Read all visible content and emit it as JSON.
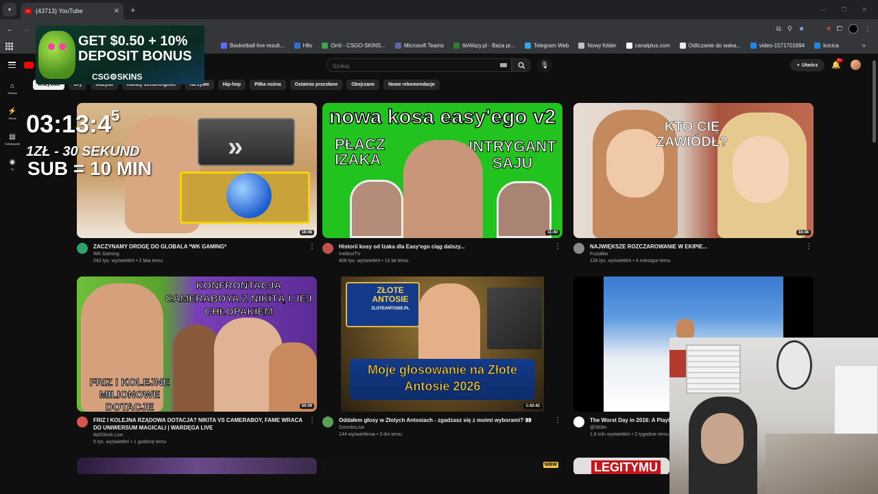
{
  "browser": {
    "tab_title": "(43713) YouTube",
    "bookmarks": [
      {
        "label": "Basketball live result...",
        "color": "#5b6bff"
      },
      {
        "label": "Hltv",
        "color": "#2f6fd6"
      },
      {
        "label": "Orrti - CSGO-SKINS...",
        "color": "#34a853"
      },
      {
        "label": "Microsoft Teams",
        "color": "#6264a7"
      },
      {
        "label": "IleWazy.pl - Baza pr...",
        "color": "#2e7d32"
      },
      {
        "label": "Telegram Web",
        "color": "#2aabee"
      },
      {
        "label": "Nowy folder",
        "color": "#bdc1c6"
      },
      {
        "label": "canalplus.com",
        "color": "#ffffff"
      },
      {
        "label": "Odliczanie do waka...",
        "color": "#e8eaed"
      },
      {
        "label": "video-1571701694",
        "color": "#1e88e5"
      },
      {
        "label": "kocica",
        "color": "#1e88e5"
      }
    ]
  },
  "youtube": {
    "search_placeholder": "Szukaj",
    "create_label": "Utwórz",
    "notif_count": "9+",
    "sidebar": [
      {
        "icon": "⌂",
        "label": "Główna"
      },
      {
        "icon": "⚡",
        "label": "Shorts"
      },
      {
        "icon": "▤",
        "label": "Subskrypcje"
      },
      {
        "icon": "◉",
        "label": "Ty"
      }
    ],
    "chips": [
      "Wszystko",
      "Gry",
      "Muzyka",
      "Kanały streamingowe",
      "Na żywo",
      "Hip-hop",
      "Piłka nożna",
      "Ostatnio przesłane",
      "Obejrzane",
      "Nowe rekomendacje"
    ],
    "videos": [
      {
        "title": "ZACZYNAMY DROGĘ DO GLOBALA *WK GAMING*",
        "channel": "WK Gaming",
        "stats": "242 tys. wyświetleń • 2 lata temu",
        "duration": "18:48",
        "avatar_color": "#2ea36b"
      },
      {
        "title": "Historii kosy od Izaka dla Easy'ego ciąg dalszy...",
        "channel": "InetkoxTV",
        "stats": "409 tys. wyświetleń • 10 lat temu",
        "duration": "11:40",
        "avatar_color": "#c05050"
      },
      {
        "title": "NAJWIĘKSZE ROZCZAROWANIE W EKIPIE...",
        "channel": "Fusialka",
        "stats": "126 tys. wyświetleń • 4 miesiące temu",
        "duration": "18:38",
        "avatar_color": "#8a8a8a"
      },
      {
        "title": "FRIZ I KOLEJNA RZĄDOWA DOTACJA? NIKITA VS CAMERABOY, FAME WRACA DO UNIWERSUM MAGICALI | WARDĘGA LIVE",
        "channel": "WATAHA Live",
        "stats": "5 tys. wyświetleń • 1 godzinę temu",
        "duration": "50:09",
        "avatar_color": "#d9534f"
      },
      {
        "title": "Oddałem głosy w Złotych Antosiach  - zgadzasz się z moimi wyborami? 👀",
        "channel": "GremlinLive",
        "stats": "144 wyświetlenia • 3 dni temu",
        "duration": "1:43:42",
        "avatar_color": "#5aa05a"
      },
      {
        "title": "The Worst Day in 2016: A Playlist",
        "channel": "@583m",
        "stats": "1,8 mln wyświetleń • 2 tygodnie temu",
        "duration": "",
        "avatar_color": "#ffffff"
      }
    ]
  },
  "thumb_texts": {
    "v2_top": "nowa kosa easy'ego v2",
    "v2_left": "PŁACZ IZAKA",
    "v2_right": "INTRYGANT SAJU",
    "v3_text": "KTO CIĘ ZAWIÓDŁ?",
    "v4_top": "KONFRONTACJA CAMERABOYA Z NIKITĄ I JEJ CHŁOPAKIEM",
    "v4_bottom": "FRIZ I KOLEJNE MILIONOWE DOTACJE",
    "v5_badge": "ZŁOTE ANTOSIE",
    "v5_badge_url": "ZLOTEANTOSIE.PL",
    "v5_caption": "Moje głosowanie na Złote Antosie 2026",
    "row3_c3": "LEGITYMU",
    "row3_badge": "WBW"
  },
  "overlay": {
    "ad_line1": "GET $0.50 + 10%",
    "ad_line2": "DEPOSIT BONUS",
    "ad_brand": "CSG⚙SKINS",
    "timer": "03:13:4",
    "timer_sup": "5",
    "rate": "1ZŁ - 30 SEKUND",
    "sub_rate": "SUB = 10 MIN"
  }
}
